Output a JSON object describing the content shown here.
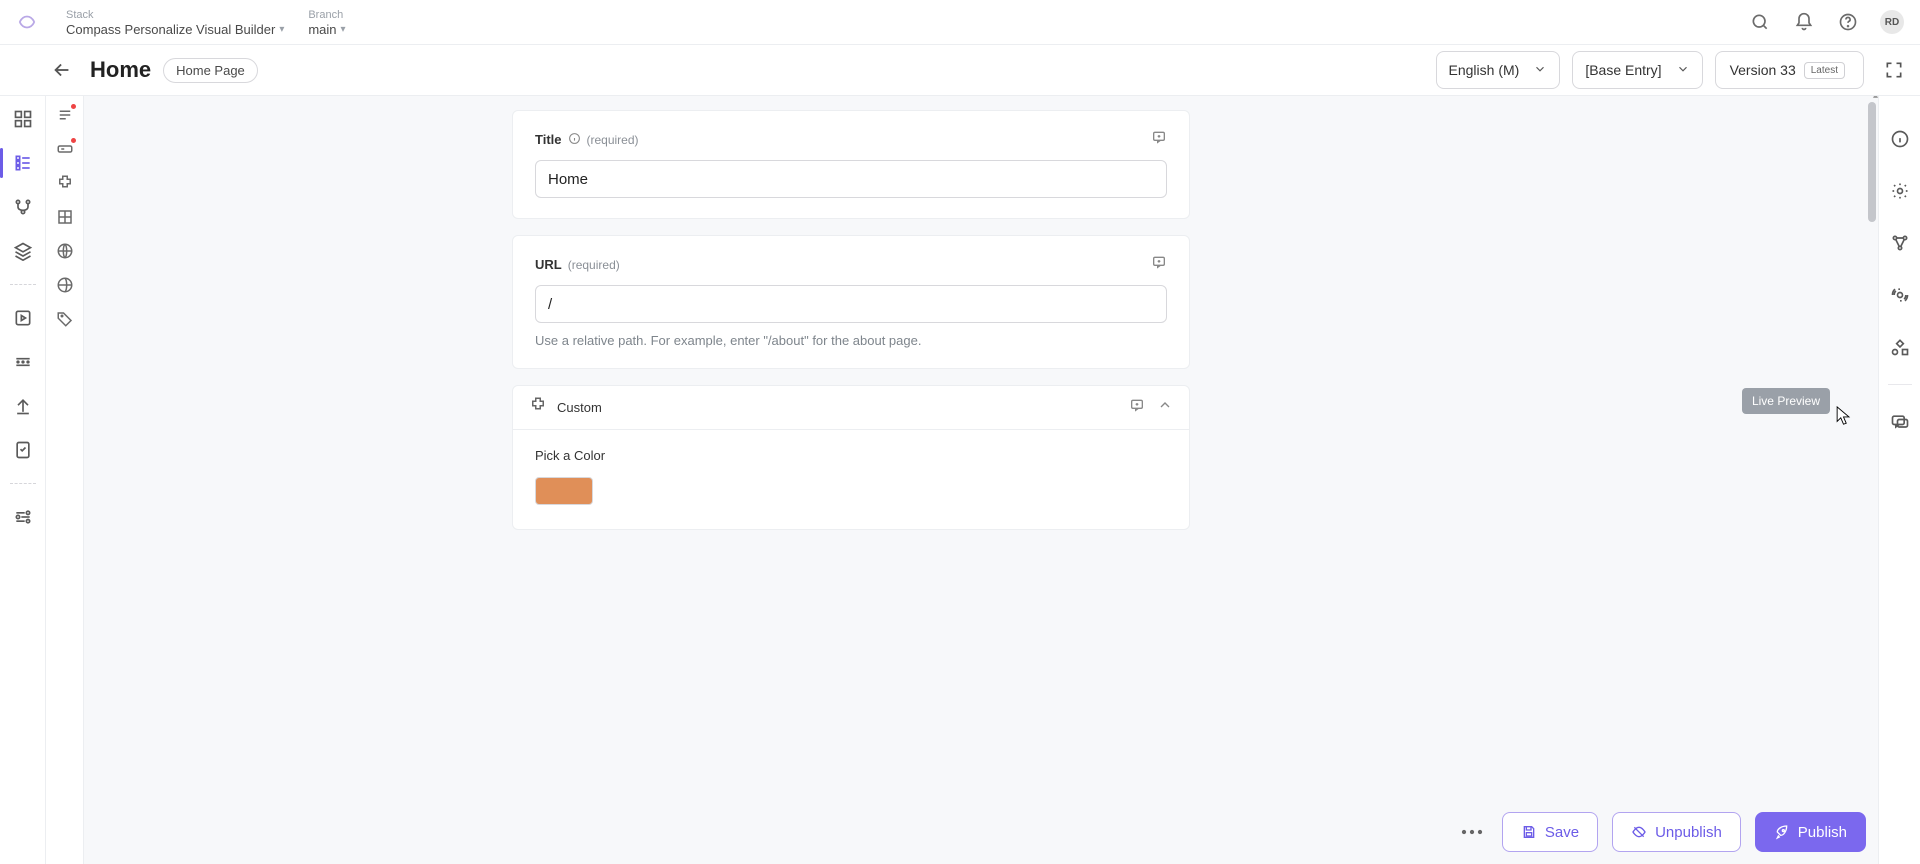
{
  "topbar": {
    "stack_label": "Stack",
    "stack_value": "Compass Personalize Visual Builder",
    "branch_label": "Branch",
    "branch_value": "main",
    "avatar_initials": "RD"
  },
  "header": {
    "page_title": "Home",
    "badge": "Home Page",
    "language": "English (M)",
    "base_entry": "[Base Entry]",
    "version": "Version 33",
    "version_chip": "Latest"
  },
  "form": {
    "title": {
      "label": "Title",
      "required_text": "(required)",
      "value": "Home"
    },
    "url": {
      "label": "URL",
      "required_text": "(required)",
      "value": "/",
      "hint": "Use a relative path. For example, enter \"/about\" for the about page."
    },
    "custom": {
      "group_title": "Custom",
      "color_label": "Pick a Color",
      "swatch_color": "#e08f58"
    }
  },
  "tooltip": {
    "live_preview": "Live Preview"
  },
  "footer": {
    "save": "Save",
    "unpublish": "Unpublish",
    "publish": "Publish"
  }
}
